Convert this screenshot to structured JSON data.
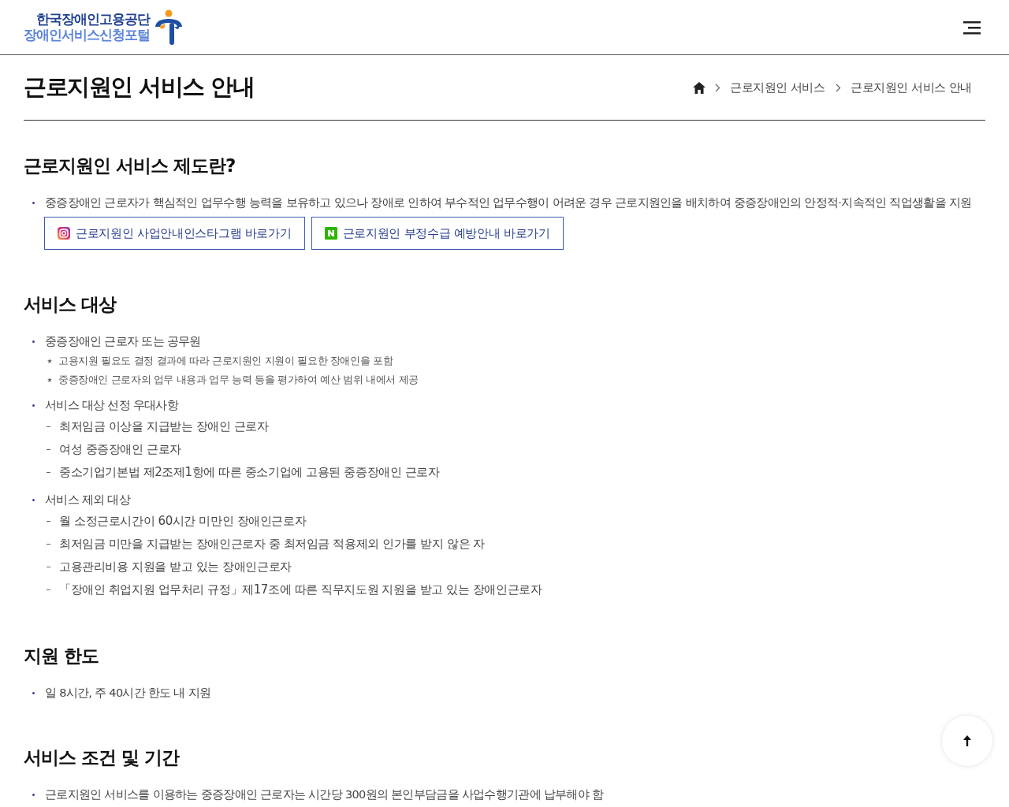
{
  "header": {
    "org_name": "한국장애인고용공단",
    "portal_name": "장애인서비스신청포털"
  },
  "page_title": "근로지원인 서비스 안내",
  "breadcrumb": [
    "근로지원인 서비스",
    "근로지원인 서비스 안내"
  ],
  "sections": [
    {
      "title": "근로지원인 서비스 제도란?",
      "items": [
        {
          "text": "중증장애인 근로자가 핵심적인 업무수행 능력을 보유하고 있으나 장애로 인하여 부수적인 업무수행이 어려운 경우 근로지원인을 배치하여 중증장애인의 안정적·지속적인 직업생활을 지원"
        }
      ],
      "links": [
        {
          "kind": "instagram",
          "label": "근로지원인 사업안내인스타그램 바로가기"
        },
        {
          "kind": "naver",
          "label": "근로지원인 부정수급 예방안내 바로가기"
        }
      ]
    },
    {
      "title": "서비스 대상",
      "items": [
        {
          "text": "중증장애인 근로자 또는 공무원",
          "notes": [
            "고용지원 필요도 결정 결과에 따라 근로지원인 지원이 필요한 장애인을 포함",
            "중증장애인 근로자의 업무 내용과 업무 능력 등을 평가하여 예산 범위 내에서 제공"
          ]
        },
        {
          "text": "서비스 대상 선정 우대사항",
          "subitems": [
            "최저임금 이상을 지급받는 장애인 근로자",
            "여성 중증장애인 근로자",
            "중소기업기본법 제2조제1항에 따른 중소기업에 고용된 중증장애인 근로자"
          ]
        },
        {
          "text": "서비스 제외 대상",
          "subitems": [
            "월 소정근로시간이 60시간 미만인 장애인근로자",
            "최저임금 미만을 지급받는 장애인근로자 중 최저임금 적용제외 인가를 받지 않은 자",
            "고용관리비용 지원을 받고 있는 장애인근로자",
            "「장애인 취업지원 업무처리 규정」제17조에 따른 직무지도원 지원을 받고 있는 장애인근로자"
          ]
        }
      ]
    },
    {
      "title": "지원 한도",
      "items": [
        {
          "text": "일 8시간, 주 40시간 한도 내 지원"
        }
      ]
    },
    {
      "title": "서비스 조건 및 기간",
      "items": [
        {
          "text": "근로지원인 서비스를 이용하는 중증장애인 근로자는 시간당 300원의 본인부담금을 사업수행기관에 납부해야 함"
        }
      ]
    }
  ]
}
